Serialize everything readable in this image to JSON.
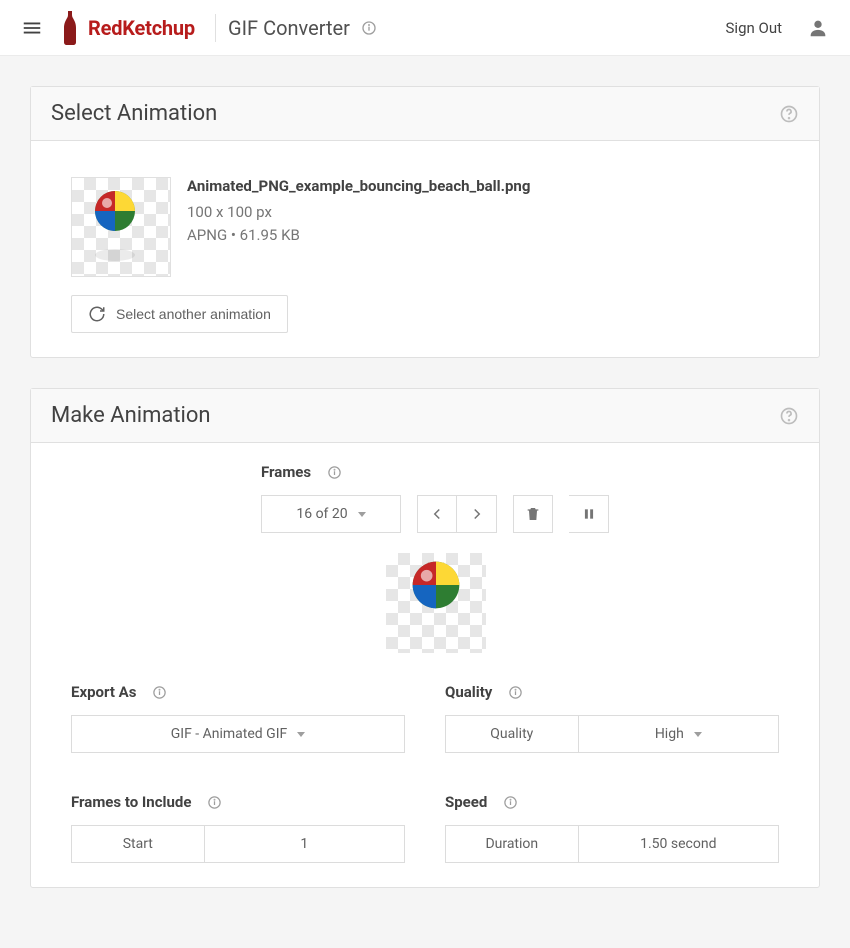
{
  "header": {
    "brand": "RedKetchup",
    "page_title": "GIF Converter",
    "sign_out": "Sign Out"
  },
  "panels": {
    "select": {
      "title": "Select Animation",
      "file": {
        "name": "Animated_PNG_example_bouncing_beach_ball.png",
        "dimensions": "100 x 100 px",
        "type_size": "APNG  •  61.95 KB"
      },
      "select_another": "Select another animation"
    },
    "make": {
      "title": "Make Animation",
      "frames_label": "Frames",
      "frame_position": "16 of 20",
      "export_as": {
        "label": "Export As",
        "value": "GIF - Animated GIF"
      },
      "quality": {
        "label": "Quality",
        "cell_label": "Quality",
        "value": "High"
      },
      "frames_to_include": {
        "label": "Frames to Include",
        "cell_label": "Start",
        "value": "1"
      },
      "speed": {
        "label": "Speed",
        "cell_label": "Duration",
        "value": "1.50 second"
      }
    }
  },
  "icons": {
    "menu": "menu-icon",
    "info": "info-icon",
    "profile": "profile-icon",
    "help": "help-icon",
    "reload": "reload-icon",
    "chev_left": "chevron-left-icon",
    "chev_right": "chevron-right-icon",
    "trash": "trash-icon",
    "pause": "pause-icon"
  },
  "colors": {
    "brand": "#b71c1c",
    "text": "#424242",
    "muted": "#757575",
    "border": "#e0e0e0",
    "bg": "#f5f5f5"
  }
}
